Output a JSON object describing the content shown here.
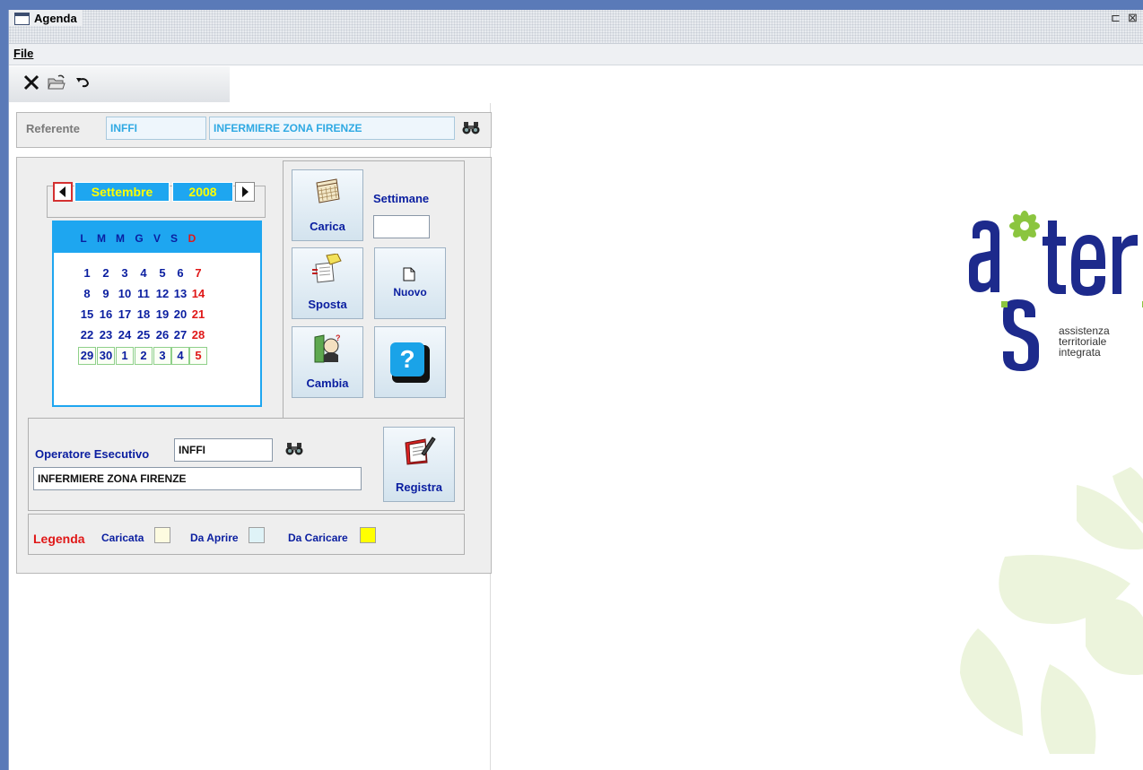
{
  "window": {
    "title": "Agenda"
  },
  "menubar": {
    "file": "File"
  },
  "toolbar": {
    "icons": [
      "close-icon",
      "open-folder-icon",
      "undo-icon"
    ]
  },
  "referente": {
    "label": "Referente",
    "code": "INFFI",
    "description": "INFERMIERE ZONA FIRENZE"
  },
  "calendar": {
    "month": "Settembre",
    "year": "2008",
    "weekdays": [
      "L",
      "M",
      "M",
      "G",
      "V",
      "S",
      "D"
    ],
    "weeks": [
      [
        "1",
        "2",
        "3",
        "4",
        "5",
        "6",
        "7"
      ],
      [
        "8",
        "9",
        "10",
        "11",
        "12",
        "13",
        "14"
      ],
      [
        "15",
        "16",
        "17",
        "18",
        "19",
        "20",
        "21"
      ],
      [
        "22",
        "23",
        "24",
        "25",
        "26",
        "27",
        "28"
      ],
      [
        "29",
        "30",
        "1",
        "2",
        "3",
        "4",
        "5"
      ]
    ]
  },
  "buttons": {
    "carica": "Carica",
    "sposta": "Sposta",
    "cambia": "Cambia",
    "nuovo": "Nuovo",
    "help": "?",
    "registra": "Registra"
  },
  "settimane": {
    "label": "Settimane",
    "value": ""
  },
  "operatore": {
    "label": "Operatore Esecutivo",
    "code": "INFFI",
    "description": "INFERMIERE ZONA FIRENZE"
  },
  "legenda": {
    "title": "Legenda",
    "items": [
      {
        "label": "Caricata",
        "color": "#fdfbe0"
      },
      {
        "label": "Da Aprire",
        "color": "#dff3f7"
      },
      {
        "label": "Da Caricare",
        "color": "#ffff00"
      }
    ]
  },
  "logo": {
    "brand": "aster",
    "tagline": [
      "assistenza",
      "territoriale",
      "integrata"
    ]
  },
  "colors": {
    "accent": "#1ea6f0",
    "navy": "#0a1ea0",
    "red": "#e01818",
    "logo_green": "#8bc53f",
    "logo_blue": "#1d2a8c"
  }
}
